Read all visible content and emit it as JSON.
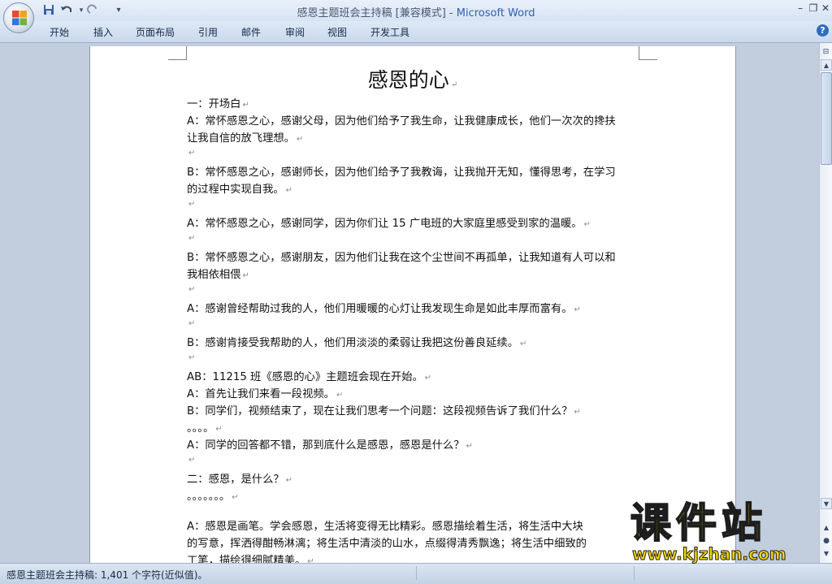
{
  "window": {
    "title_doc": "感恩主题班会主持稿 [兼容模式] - ",
    "title_app": "Microsoft Word",
    "controls": {
      "minimize": "–",
      "restore": "❐",
      "close": "✕"
    }
  },
  "quick_access": {
    "save_icon": "save-icon",
    "undo_icon": "undo-icon",
    "redo_icon": "redo-icon",
    "customize_icon": "customize-icon"
  },
  "ribbon": {
    "tabs": [
      "开始",
      "插入",
      "页面布局",
      "引用",
      "邮件",
      "审阅",
      "视图",
      "开发工具"
    ],
    "help": "?"
  },
  "document": {
    "title": "感恩的心",
    "lines": [
      "一：开场白",
      "A：常怀感恩之心，感谢父母，因为他们给予了我生命，让我健康成长，他们一次次的搀扶",
      "让我自信的放飞理想。",
      "",
      "B：常怀感恩之心，感谢师长，因为他们给予了我教诲，让我抛开无知，懂得思考，在学习",
      "的过程中实现自我。",
      "",
      "A：常怀感恩之心，感谢同学，因为你们让 15 广电班的大家庭里感受到家的温暖。",
      "",
      "B：常怀感恩之心，感谢朋友，因为他们让我在这个尘世间不再孤单，让我知道有人可以和",
      "我相依相偎",
      "",
      "A：感谢曾经帮助过我的人，他们用暖暖的心灯让我发现生命是如此丰厚而富有。",
      "",
      "B：感谢肯接受我帮助的人，他们用淡淡的柔弱让我把这份善良延续。",
      "",
      "AB：11215 班《感恩的心》主题班会现在开始。",
      "A：首先让我们来看一段视频。",
      "B：同学们，视频结束了，现在让我们思考一个问题：这段视频告诉了我们什么？",
      "。。。。",
      "A：同学的回答都不错，那到底什么是感恩，感恩是什么？",
      "",
      "二：感恩，是什么？",
      "。。。。。。。",
      "",
      "A：感恩是画笔。学会感恩，生活将变得无比精彩。感恩描绘着生活，将生活中大块",
      "的写意，挥洒得酣畅淋漓；将生活中清淡的山水，点缀得清秀飘逸；将生活中细致的",
      "工笔，描绘得细腻精美。"
    ],
    "paragraph_mark": "↵"
  },
  "status_bar": {
    "text": "感恩主题班会主持稿: 1,401 个字符(近似值)。"
  },
  "watermark": {
    "text": "课件站",
    "url": "www.kjzhan.com"
  },
  "scrollbar": {
    "up": "▲",
    "down": "▼",
    "prev_page": "▲",
    "browse": "●",
    "next_page": "▼",
    "split": "⊟"
  }
}
